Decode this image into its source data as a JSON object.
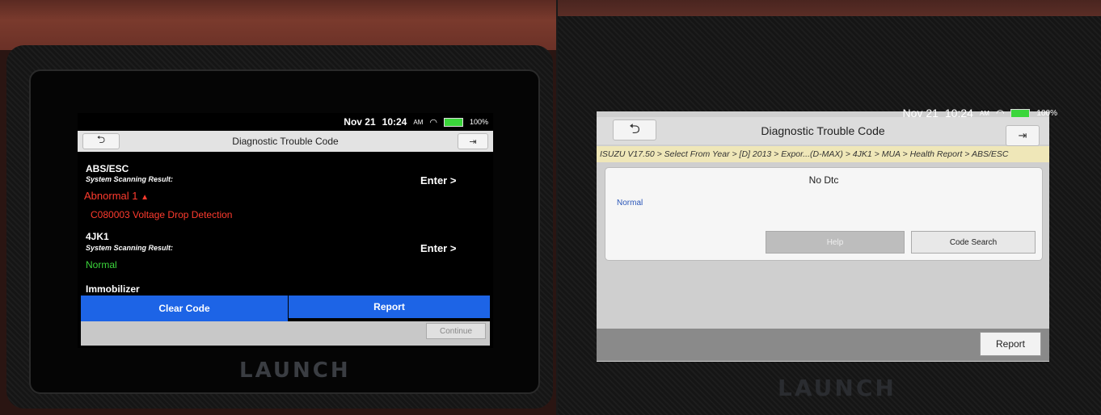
{
  "left": {
    "status": {
      "date": "Nov 21",
      "time": "10:24",
      "ampm": "AM",
      "battery": "100%"
    },
    "title": "Diagnostic Trouble Code",
    "items": [
      {
        "name": "ABS/ESC",
        "label": "System Scanning Result:",
        "result": "Abnormal 1",
        "code": "C080003 Voltage Drop Detection",
        "action": "Enter >"
      },
      {
        "name": "4JK1",
        "label": "System Scanning Result:",
        "result": "Normal",
        "action": "Enter >"
      },
      {
        "name": "Immobilizer"
      }
    ],
    "buttons": {
      "clear": "Clear Code",
      "report": "Report",
      "continue": "Continue"
    },
    "brand": "LAUNCH"
  },
  "right": {
    "status": {
      "date": "Nov 21",
      "time": "10:24",
      "ampm": "AM",
      "battery": "100%"
    },
    "title": "Diagnostic Trouble Code",
    "breadcrumb": "ISUZU V17.50 > Select From Year > [D] 2013 > Expor...(D-MAX) > 4JK1 > MUA > Health Report > ABS/ESC",
    "dtc": "No Dtc",
    "status_text": "Normal",
    "buttons": {
      "help": "Help",
      "code_search": "Code Search",
      "report": "Report"
    },
    "brand": "LAUNCH"
  },
  "colors": {
    "abnormal": "#ff3b2e",
    "normal": "#3bd63b",
    "action_bar": "#1d64e6"
  }
}
